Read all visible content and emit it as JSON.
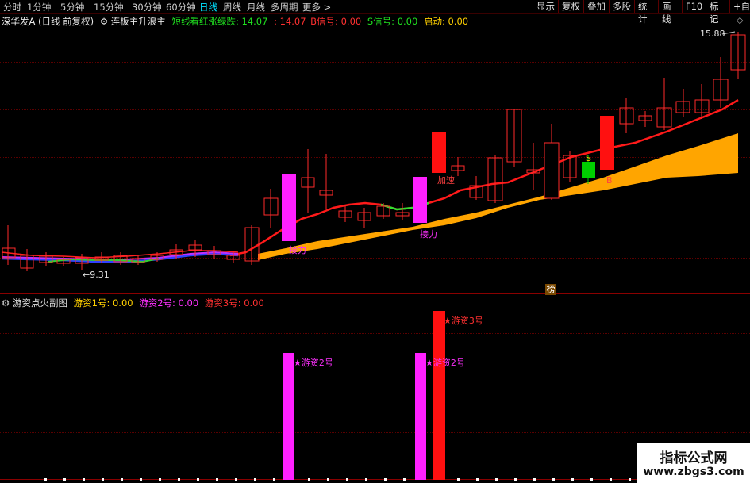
{
  "timeframes": [
    {
      "label": "分时",
      "active": false
    },
    {
      "label": "1分钟",
      "active": false
    },
    {
      "label": "5分钟",
      "active": false
    },
    {
      "label": "15分钟",
      "active": false
    },
    {
      "label": "30分钟",
      "active": false
    },
    {
      "label": "60分钟",
      "active": false
    },
    {
      "label": "日线",
      "active": true
    },
    {
      "label": "周线",
      "active": false
    },
    {
      "label": "月线",
      "active": false
    },
    {
      "label": "多周期",
      "active": false
    },
    {
      "label": "更多 >",
      "active": false
    }
  ],
  "toolbar": [
    "显示",
    "复权",
    "叠加",
    "多股",
    "统计",
    "画线",
    "F10",
    "标记",
    "+自"
  ],
  "main": {
    "stock": "深华发A",
    "mode": "(日线 前复权)",
    "indicator": "连板主升浪主",
    "l1": "短线看红涨绿跌: 14.07",
    "l2": ": 14.07",
    "l3": "B信号: 0.00",
    "l4": "S信号: 0.00",
    "l5": "启动: 0.00",
    "high_label": "15.88",
    "low_label": "9.31",
    "ann_jieli1": "接力",
    "ann_jieli2": "接力",
    "ann_jiasu": "加速",
    "ann_s": "S",
    "ann_b": "B",
    "ann_bang": "榜"
  },
  "sub": {
    "indicator": "游资点火副图",
    "y1": "游资1号: 0.00",
    "y2": "游资2号: 0.00",
    "y3": "游资3号: 0.00",
    "ann1": "游资2号",
    "ann2": "游资2号",
    "ann3": "游资3号"
  },
  "watermark": {
    "title": "指标公式网",
    "url": "www.zbgs3.com"
  },
  "colors": {
    "up": "#ff2a2a",
    "down": "#00c8ff",
    "band": "#ffa500",
    "magenta": "#ff20ff",
    "red": "#ff1010",
    "green": "#00d000"
  }
}
